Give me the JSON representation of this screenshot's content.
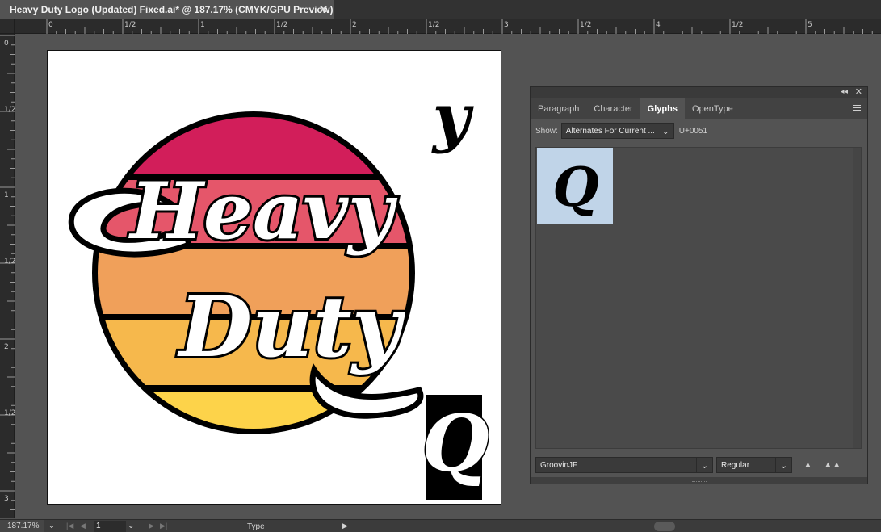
{
  "document_tab": {
    "title": "Heavy Duty Logo (Updated) Fixed.ai* @ 187.17% (CMYK/GPU Preview)",
    "close_label": "✕"
  },
  "rulers": {
    "top_labels": [
      "0",
      "1/2",
      "1",
      "1/2",
      "2",
      "1/2",
      "3",
      "1/2",
      "4",
      "1/2",
      "5"
    ],
    "left_labels": [
      "0",
      "1/2",
      "1",
      "1/2",
      "2",
      "1/2",
      "3"
    ]
  },
  "artwork": {
    "logo_text": [
      "Heavy",
      "Duty"
    ],
    "stray_glyph_top": "y",
    "stray_glyph_bottom": "Q",
    "stripe_colors": [
      "#d21e5a",
      "#e5566a",
      "#f0a05a",
      "#f6b84c",
      "#fdd34a"
    ]
  },
  "glyphs_panel": {
    "tabs": [
      "Paragraph",
      "Character",
      "Glyphs",
      "OpenType"
    ],
    "active_tab": "Glyphs",
    "show_label": "Show:",
    "show_value": "Alternates For Current ...",
    "unicode": "U+0051",
    "selected_glyph": "Q",
    "font_family": "GroovinJF",
    "font_style": "Regular"
  },
  "status_bar": {
    "zoom": "187.17%",
    "page": "1",
    "tool": "Type"
  }
}
